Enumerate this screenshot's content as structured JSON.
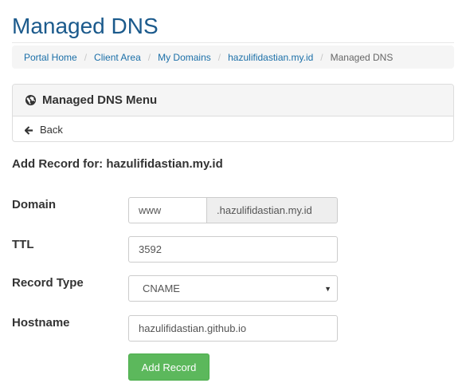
{
  "page": {
    "title": "Managed DNS"
  },
  "breadcrumb": {
    "items": [
      "Portal Home",
      "Client Area",
      "My Domains",
      "hazulifidastian.my.id"
    ],
    "active": "Managed DNS",
    "separator": "/"
  },
  "menu_panel": {
    "title": "Managed DNS Menu",
    "title_icon": "globe-icon",
    "back_label": "Back",
    "back_icon": "arrow-left-icon"
  },
  "form": {
    "heading": "Add Record for: hazulifidastian.my.id",
    "domain": {
      "label": "Domain",
      "value": "www",
      "suffix": ".hazulifidastian.my.id"
    },
    "ttl": {
      "label": "TTL",
      "value": "3592"
    },
    "record_type": {
      "label": "Record Type",
      "value": "CNAME"
    },
    "hostname": {
      "label": "Hostname",
      "value": "hazulifidastian.github.io"
    },
    "submit_label": "Add Record"
  },
  "colors": {
    "title": "#1b5a8c",
    "link": "#1b6fa8",
    "button": "#5cb85c",
    "panel_bg": "#f5f5f5"
  }
}
